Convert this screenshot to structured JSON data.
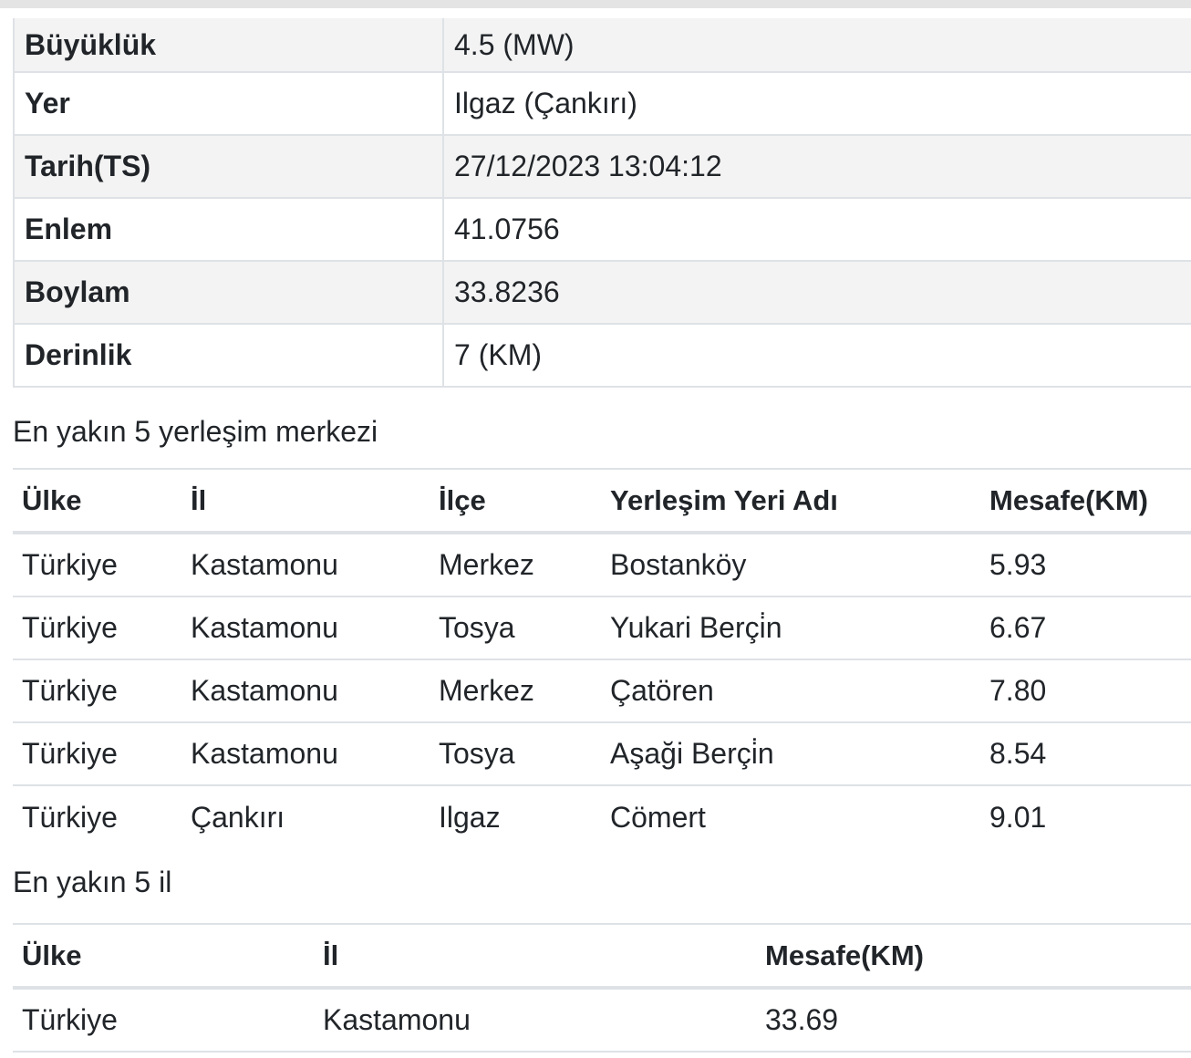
{
  "details": [
    {
      "label": "Büyüklük",
      "value": "4.5 (MW)"
    },
    {
      "label": "Yer",
      "value": "Ilgaz (Çankırı)"
    },
    {
      "label": "Tarih(TS)",
      "value": "27/12/2023 13:04:12"
    },
    {
      "label": "Enlem",
      "value": "41.0756"
    },
    {
      "label": "Boylam",
      "value": "33.8236"
    },
    {
      "label": "Derinlik",
      "value": "7 (KM)"
    }
  ],
  "settlements": {
    "title": "En yakın 5 yerleşim merkezi",
    "headers": [
      "Ülke",
      "İl",
      "İlçe",
      "Yerleşim Yeri Adı",
      "Mesafe(KM)"
    ],
    "rows": [
      [
        "Türkiye",
        "Kastamonu",
        "Merkez",
        "Bostanköy",
        "5.93"
      ],
      [
        "Türkiye",
        "Kastamonu",
        "Tosya",
        "Yukari Berçi̇n",
        "6.67"
      ],
      [
        "Türkiye",
        "Kastamonu",
        "Merkez",
        "Çatören",
        "7.80"
      ],
      [
        "Türkiye",
        "Kastamonu",
        "Tosya",
        "Aşaği Berçi̇n",
        "8.54"
      ],
      [
        "Türkiye",
        "Çankırı",
        "Ilgaz",
        "Cömert",
        "9.01"
      ]
    ]
  },
  "provinces": {
    "title": "En yakın 5 il",
    "headers": [
      "Ülke",
      "İl",
      "Mesafe(KM)"
    ],
    "rows": [
      [
        "Türkiye",
        "Kastamonu",
        "33.69"
      ]
    ]
  }
}
